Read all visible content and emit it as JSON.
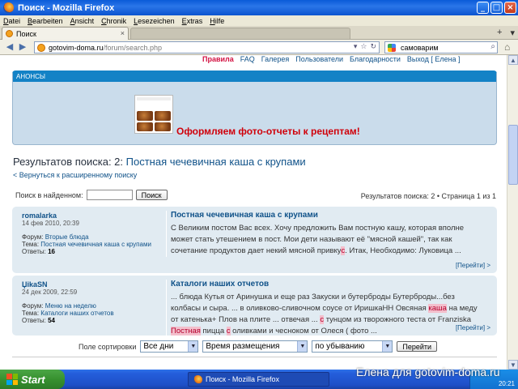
{
  "window": {
    "title": "Поиск - Mozilla Firefox",
    "btn_min": "_",
    "btn_max": "□",
    "btn_close": "×"
  },
  "menu": [
    "Datei",
    "Bearbeiten",
    "Ansicht",
    "Chronik",
    "Lesezeichen",
    "Extras",
    "Hilfe"
  ],
  "tabs": {
    "active_label": "Поиск",
    "close": "×",
    "new_tab": "+"
  },
  "nav": {
    "url_host": "gotovim-doma.ru",
    "url_path": "/forum/search.php",
    "search_value": "самоварим"
  },
  "top_links": {
    "rules": "Правила",
    "faq": "FAQ",
    "gallery": "Галерея",
    "users": "Пользователи",
    "thanks": "Благодарности",
    "logout": "Выход [ Елена ]"
  },
  "announce": {
    "header": "АНОНСЫ",
    "text": "Оформляем фото-отчеты к рецептам!"
  },
  "results": {
    "title_prefix": "Результатов поиска: 2:",
    "title_query": "Постная чечевичная каша с крупами",
    "back_link": "< Вернуться к расширенному поиску",
    "search_in_label": "Поиск в найденном:",
    "search_btn": "Поиск",
    "pagination": "Результатов поиска: 2 • Страница 1 из 1"
  },
  "posts": [
    {
      "author": "romalarka",
      "date": "14 фев 2010, 20:39",
      "forum_label": "Форум:",
      "forum": "Вторые блюда",
      "topic_label": "Тема:",
      "topic": "Постная чечевичная каша с крупами",
      "replies_label": "Ответы:",
      "replies": "16",
      "title": "Постная чечевичная каша с крупами",
      "body_pre": "С Великим постом Вас всех. Хочу предложить Вам постную кашу, которая вполне может стать утешением в пост. Мои дети называют её \"мясной кашей\", так как сочетание продуктов дает некий мясной привку",
      "body_hl": "с",
      "body_post": ". Итак, Необходимо: Луковица ...",
      "more": "[Перейти] >"
    },
    {
      "author": "ЏikaSN",
      "date": "24 дек 2009, 22:59",
      "forum_label": "Форум:",
      "forum": "Меню на неделю",
      "topic_label": "Тема:",
      "topic": "Каталоги наших отчетов",
      "replies_label": "Ответы:",
      "replies": "54",
      "title": "Каталоги наших отчетов",
      "body_a": "... блюда Кутья от Аринушка и еще раз Закуски и бутерброды Бутерброды...без колбасы и сыра. ... в оливково-сливочном соусе от ИришкаНН Овсяная ",
      "hl1": "каша",
      "body_b": " на меду от катенька+ Плов на плите ... отвечая ... ",
      "hl2": "с",
      "body_c": " тунцом из творожного теста от Franziska ",
      "hl3": "Постная",
      "body_d": " пицца ",
      "hl4": "с",
      "body_e": " оливками и чесноком от Олеся ( фото ...",
      "more": "[Перейти] >"
    }
  ],
  "sort": {
    "label": "Поле сортировки",
    "days": "Все дни",
    "field": "Время размещения",
    "order": "по убыванию",
    "go": "Перейти"
  },
  "taskbar": {
    "start": "Start",
    "task": "Поиск - Mozilla Firefox",
    "clock": "20:21"
  },
  "watermark": "Елена для gotovim-doma.ru"
}
